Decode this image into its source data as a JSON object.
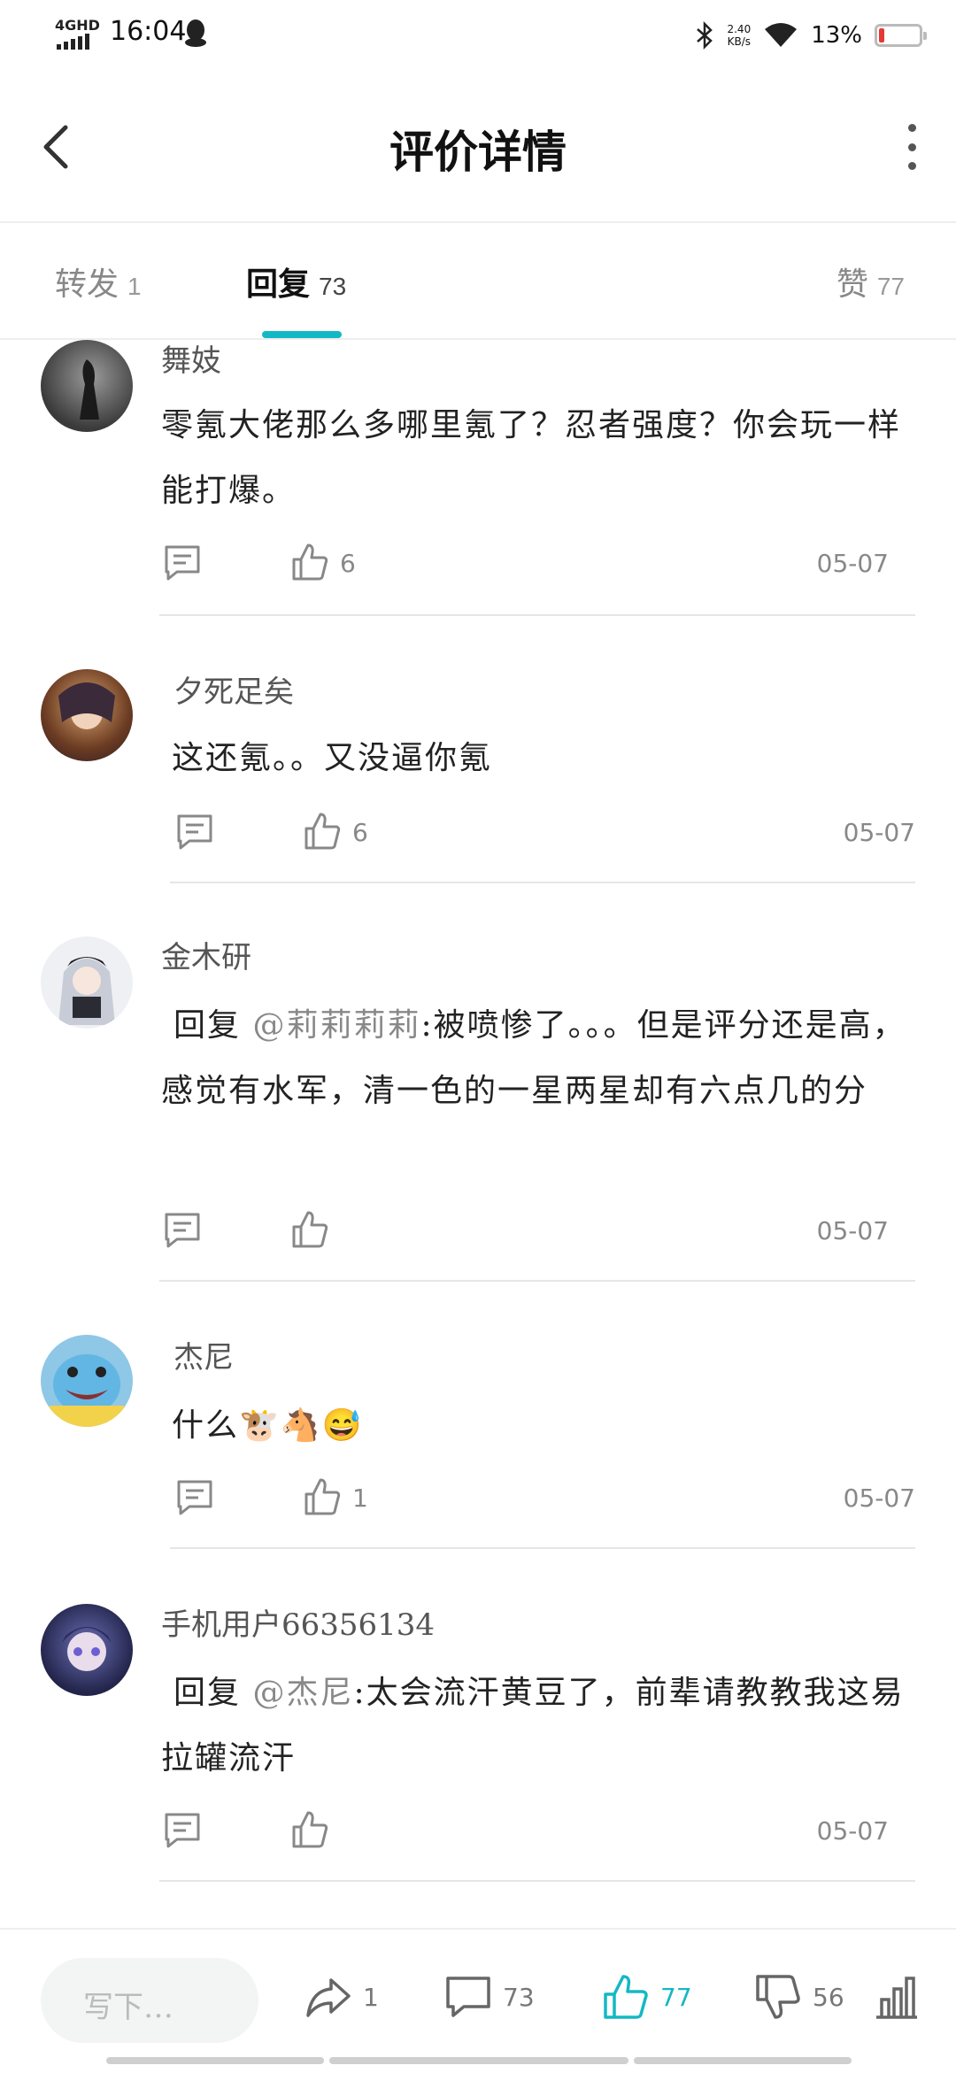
{
  "status_bar": {
    "network": "4GHD",
    "time": "16:04",
    "speed_value": "2.40",
    "speed_unit": "KB/s",
    "battery": "13%",
    "battery_level": 0.13
  },
  "header": {
    "title": "评价详情"
  },
  "tabs": [
    {
      "label": "转发",
      "count": "1"
    },
    {
      "label": "回复",
      "count": "73"
    },
    {
      "label": "赞",
      "count": "77"
    }
  ],
  "replies": [
    {
      "username": "舞妓",
      "text": "零氪大佬那么多哪里氪了？忍者强度？你会玩一样能打爆。",
      "reply_prefix": "",
      "mention": "",
      "likes": "6",
      "date": "05-07"
    },
    {
      "username": "夕死足矣",
      "text": "这还氪。。又没逼你氪",
      "reply_prefix": "",
      "mention": "",
      "likes": "6",
      "date": "05-07"
    },
    {
      "username": "金木研",
      "reply_prefix": "回复 ",
      "mention": "@莉莉莉莉",
      "text": ":被喷惨了。。。但是评分还是高，感觉有水军，清一色的一星两星却有六点几的分",
      "likes": "",
      "date": "05-07"
    },
    {
      "username": "杰尼",
      "text": "什么🐮🐴😅",
      "reply_prefix": "",
      "mention": "",
      "likes": "1",
      "date": "05-07"
    },
    {
      "username": "手机用户66356134",
      "reply_prefix": "回复 ",
      "mention": "@杰尼",
      "text": ":太会流汗黄豆了，前辈请教教我这易拉罐流汗",
      "likes": "",
      "date": "05-07"
    }
  ],
  "bottom_bar": {
    "input_placeholder": "写下…",
    "share_count": "1",
    "comment_count": "73",
    "like_count": "77",
    "dislike_count": "56"
  },
  "colors": {
    "accent": "#14b8c4",
    "battery_low": "#e53935"
  }
}
